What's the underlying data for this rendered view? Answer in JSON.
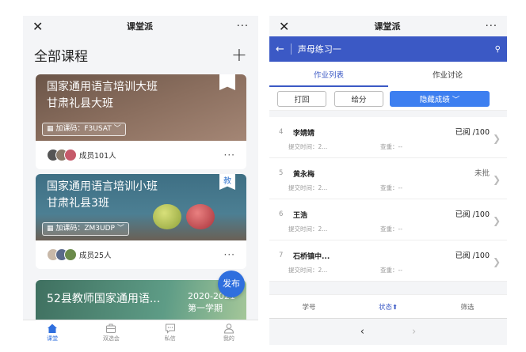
{
  "left": {
    "titlebar": {
      "close": "✕",
      "title": "课堂派",
      "more": "···"
    },
    "header": {
      "title": "全部课程",
      "add": "+"
    },
    "cards": [
      {
        "line1": "国家通用语言培训大班",
        "line2": "甘肃礼县大班",
        "code": "加课码：F3USAT",
        "members": "成员101人",
        "more": "···"
      },
      {
        "line1": "国家通用语言培训小班",
        "line2": "甘肃礼县3班",
        "code": "加课码：ZM3UDP",
        "members": "成员25人",
        "more": "···",
        "badge": "教"
      },
      {
        "line1": "52县教师国家通用语...",
        "term1": "2020-2021",
        "term2": "第一学期"
      }
    ],
    "publish": "发布",
    "tabs": [
      {
        "label": "课堂",
        "icon": "home-icon"
      },
      {
        "label": "双选会",
        "icon": "briefcase-icon"
      },
      {
        "label": "私信",
        "icon": "message-icon"
      },
      {
        "label": "我的",
        "icon": "user-icon"
      }
    ]
  },
  "right": {
    "titlebar": {
      "close": "✕",
      "title": "课堂派",
      "more": "···"
    },
    "header": {
      "back": "←",
      "title": "声母练习一",
      "search": "⚲"
    },
    "tabs": [
      {
        "label": "作业列表"
      },
      {
        "label": "作业讨论"
      }
    ],
    "actions": {
      "return": "打回",
      "grade": "给分",
      "hide": "隐藏成绩 ﹀"
    },
    "rows": [
      {
        "num": "4",
        "name": "李婧婧",
        "status": "已阅 /100",
        "submit": "提交时间：2...",
        "dup": "查重：--"
      },
      {
        "num": "5",
        "name": "黄永梅",
        "status": "未批",
        "submit": "提交时间：2...",
        "dup": "查重：--"
      },
      {
        "num": "6",
        "name": "王浩",
        "status": "已阅 /100",
        "submit": "提交时间：2...",
        "dup": "查重：--"
      },
      {
        "num": "7",
        "name": "石桥镇中...",
        "status": "已阅 /100",
        "submit": "提交时间：2...",
        "dup": "查重：--"
      }
    ],
    "sort": {
      "id": "学号",
      "state": "状态⬆",
      "filter": "筛选"
    },
    "nav": {
      "back": "‹",
      "forward": "›"
    }
  }
}
